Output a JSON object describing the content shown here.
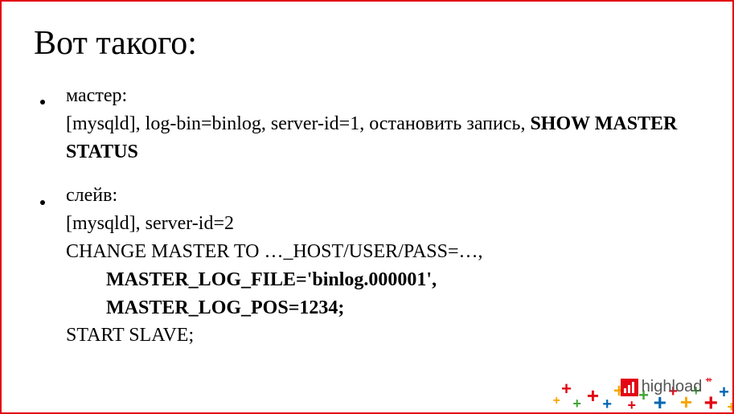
{
  "title": "Вот такого:",
  "items": [
    {
      "label": "мастер:",
      "line1_plain": "[mysqld], log-bin=binlog, server-id=1, остановить запись, ",
      "line1_bold": "SHOW MASTER STATUS"
    },
    {
      "label": "слейв:",
      "line_a": "[mysqld], server-id=2",
      "line_b": "CHANGE MASTER TO …_HOST/USER/PASS=…,",
      "line_c_bold": "MASTER_LOG_FILE='binlog.000001',",
      "line_d_bold": "MASTER_LOG_POS=1234;",
      "line_e": "START SLAVE;"
    }
  ],
  "logo": {
    "text": "highload",
    "plus": "++"
  }
}
